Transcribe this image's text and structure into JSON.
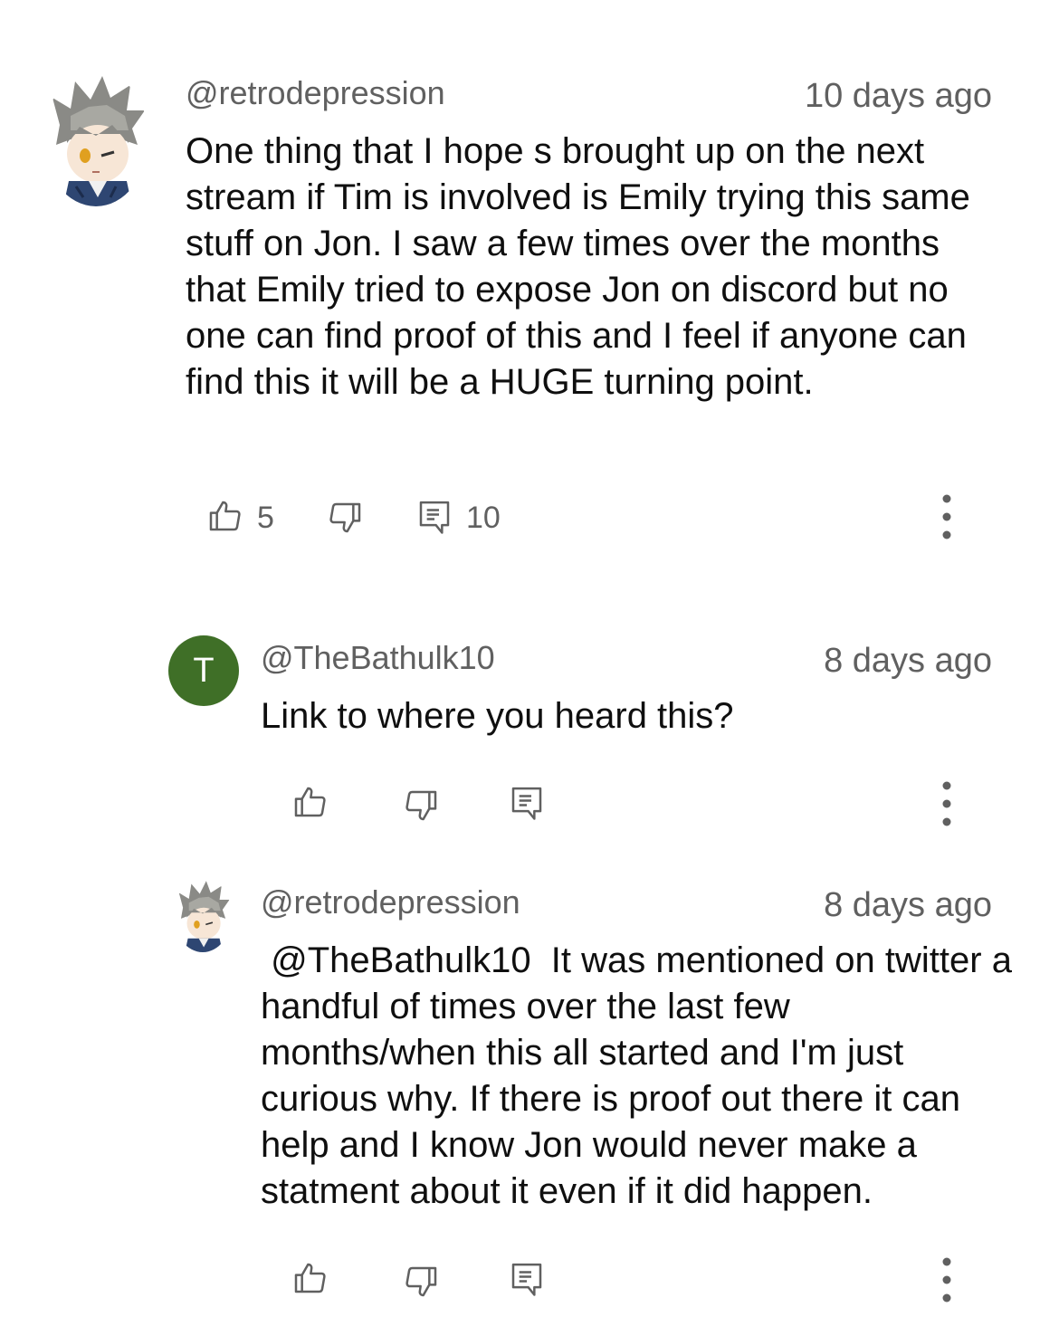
{
  "comments": [
    {
      "handle": "@retrodepression",
      "time": "10 days ago",
      "text": "One thing that I hope s brought up on the next stream if Tim is involved is Emily trying this same stuff on Jon. I saw a few times over the months that Emily tried to expose Jon on discord but no one can find proof of this and I feel if anyone can find this it will be a HUGE turning point.",
      "likes": "5",
      "replies": "10",
      "avatar": "anime-character-avatar"
    },
    {
      "handle": "@TheBathulk10",
      "time": "8 days ago",
      "text": "Link to where you heard this?",
      "avatar_letter": "T",
      "avatar_color": "#3f6f27"
    },
    {
      "handle": "@retrodepression",
      "time": "8 days ago",
      "text": " @TheBathulk10  It was mentioned on twitter a handful of times over the last few months/when this all started and I'm just curious why. If there is proof out there it can help and I know Jon would never make a statment about it even if it did happen.",
      "avatar": "anime-character-avatar"
    }
  ],
  "icons": {
    "like": "thumbs-up-icon",
    "dislike": "thumbs-down-icon",
    "reply": "reply-comment-icon",
    "more": "vertical-ellipsis-icon"
  }
}
